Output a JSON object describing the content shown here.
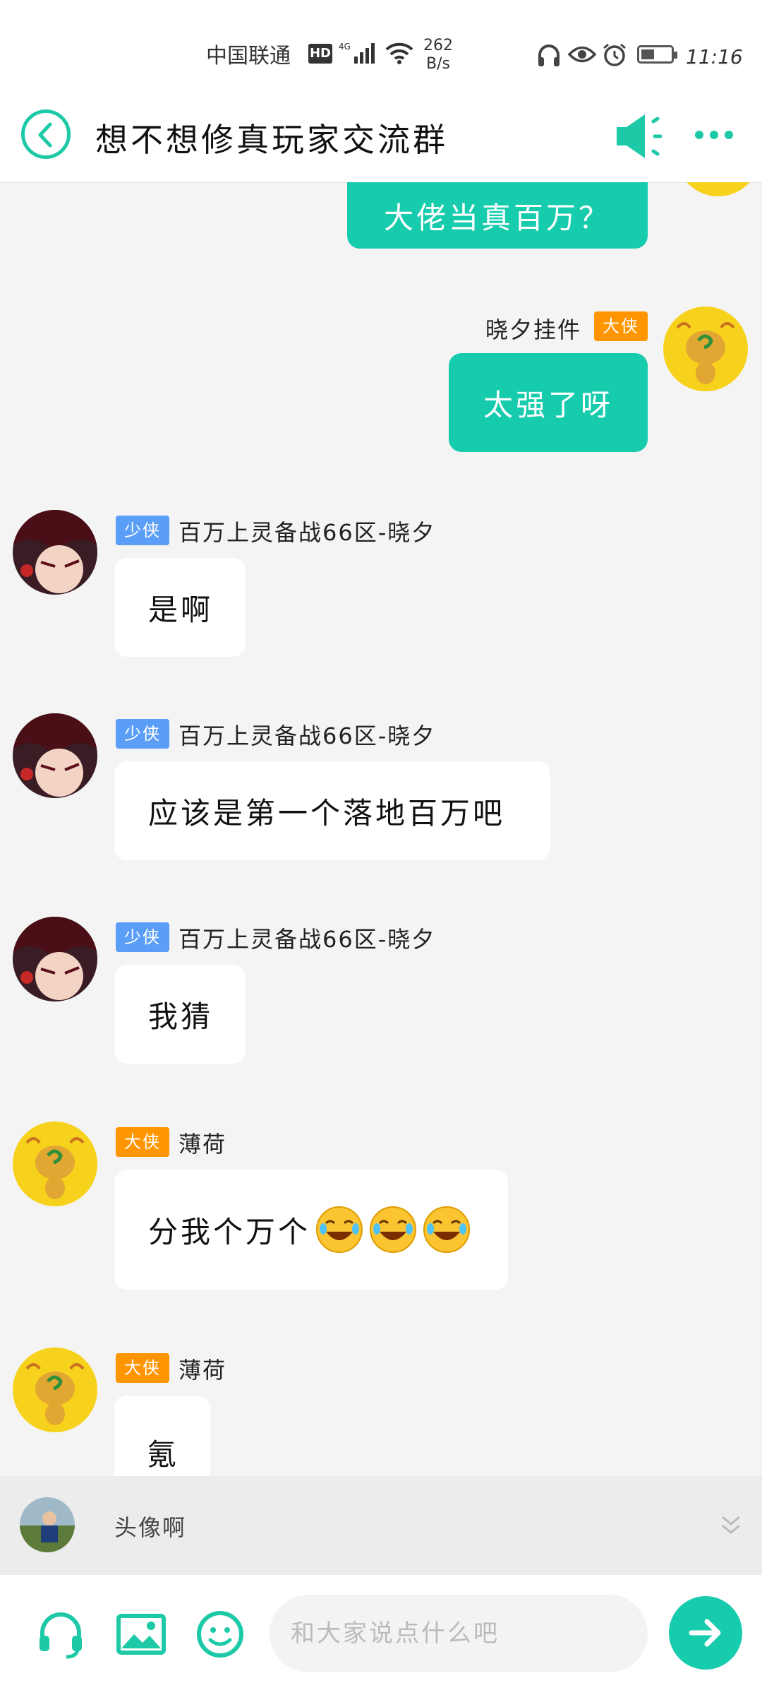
{
  "status_bar": {
    "carrier": "中国联通",
    "hd": "HD",
    "network": "4G",
    "speed_value": "262",
    "speed_unit": "B/s",
    "battery_level": 0.45,
    "time": "11:16"
  },
  "header": {
    "title": "想不想修真玩家交流群",
    "back_icon": "chevron-left-icon",
    "speaker_icon": "speaker-icon",
    "more_icon": "more-dots-icon"
  },
  "messages": [
    {
      "side": "mine",
      "text": "大佬当真百万？"
    },
    {
      "side": "mine",
      "badge": "大侠",
      "sender": "晓夕挂件",
      "text": "太强了呀"
    },
    {
      "side": "theirs",
      "badge": "少侠",
      "sender": "百万上灵备战66区-晓夕",
      "text": "是啊"
    },
    {
      "side": "theirs",
      "badge": "少侠",
      "sender": "百万上灵备战66区-晓夕",
      "text": "应该是第一个落地百万吧"
    },
    {
      "side": "theirs",
      "badge": "少侠",
      "sender": "百万上灵备战66区-晓夕",
      "text": "我猜"
    },
    {
      "side": "theirs",
      "badge": "大侠",
      "sender": "薄荷",
      "text": "分我个万个",
      "emojis": [
        "laughing-tears-emoji",
        "laughing-tears-emoji",
        "laughing-tears-emoji"
      ]
    },
    {
      "side": "theirs",
      "badge": "大侠",
      "sender": "薄荷",
      "text": "氪"
    }
  ],
  "quick_bar": {
    "text": "头像啊",
    "collapse_icon": "double-chevron-down-icon"
  },
  "input_bar": {
    "placeholder": "和大家说点什么吧",
    "icons": [
      "headset-icon",
      "image-icon",
      "emoji-icon"
    ],
    "send_icon": "arrow-right-icon"
  },
  "colors": {
    "accent": "#17cbad",
    "badge_small": "#5b9ef8",
    "badge_big": "#ff9500"
  }
}
